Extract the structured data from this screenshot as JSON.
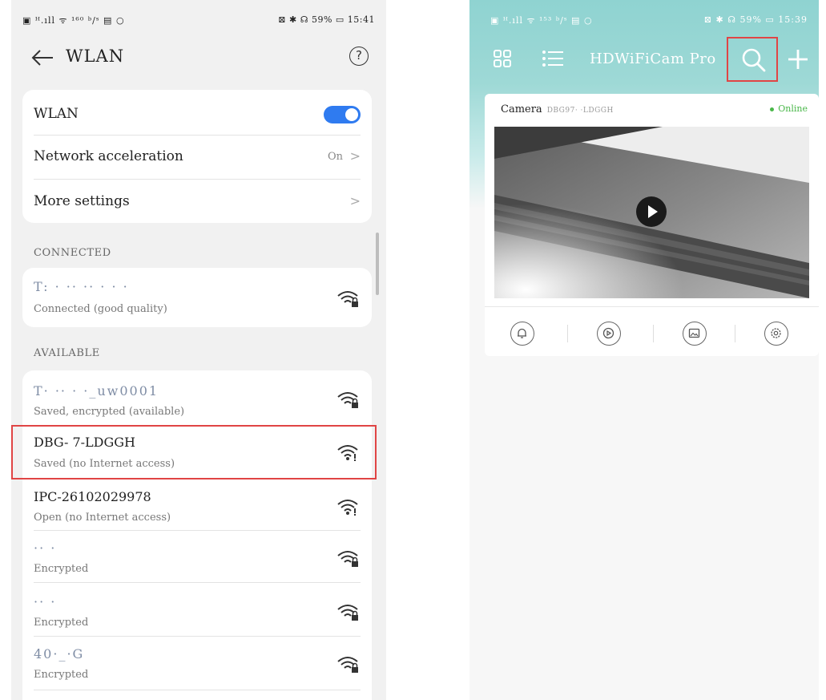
{
  "left": {
    "statusbar": {
      "left": "▣ ᴴ.ıll ᯤ ¹⁶⁰ ᵇ/ˢ ▤ ○",
      "right": "⊠ ✱ ☊ 59% ▭ 15:41"
    },
    "title": "WLAN",
    "help_glyph": "?",
    "settings": {
      "wlan_label": "WLAN",
      "wlan_on": true,
      "acceleration_label": "Network acceleration",
      "acceleration_value": "On",
      "more_label": "More settings"
    },
    "connected_header": "CONNECTED",
    "connected": {
      "name": "T: · ·· ·· · · ·",
      "status": "Connected (good quality)"
    },
    "available_header": "AVAILABLE",
    "networks": [
      {
        "name": "T· ·· · ·_uw0001",
        "status": "Saved, encrypted (available)",
        "icon": "wifi-lock-icon"
      },
      {
        "name": "DBG-          7-LDGGH",
        "status": "Saved (no Internet access)",
        "icon": "wifi-alert-icon"
      },
      {
        "name": "IPC-26102029978",
        "status": "Open (no Internet access)",
        "icon": "wifi-alert-icon"
      },
      {
        "name": "·· ·",
        "status": "Encrypted",
        "icon": "wifi-lock-icon"
      },
      {
        "name": "·· ·",
        "status": "Encrypted",
        "icon": "wifi-lock-icon"
      },
      {
        "name": "40·_·G",
        "status": "Encrypted",
        "icon": "wifi-lock-icon"
      }
    ]
  },
  "right": {
    "statusbar": {
      "left": "▣ ᴴ.ıll ᯤ ¹⁵³ ᵇ/ˢ ▤ ○",
      "right": "⊠ ✱ ☊ 59% ▭ 15:39"
    },
    "app_title": "HDWiFiCam Pro",
    "camera": {
      "label": "Camera",
      "id": "DBG97·      ·LDGGH",
      "status": "Online"
    },
    "actions": [
      "bell-icon",
      "playback-icon",
      "gallery-icon",
      "settings-icon"
    ],
    "colors": {
      "header": "#8fd3d1",
      "online": "#49b749",
      "highlight": "#e04545",
      "toggle": "#2f7bf0"
    }
  }
}
